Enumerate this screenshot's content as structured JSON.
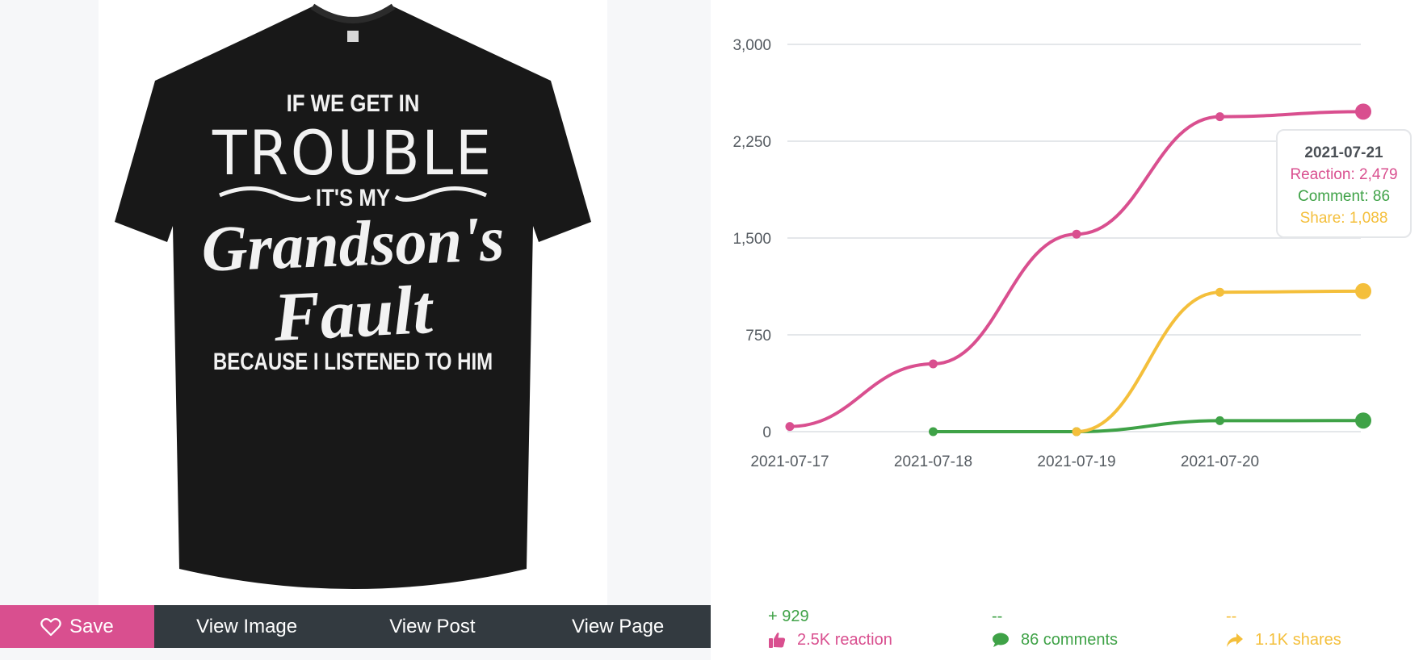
{
  "product": {
    "shirt_text": [
      "IF WE GET IN",
      "TROUBLE",
      "IT'S MY",
      "Grandson's",
      "Fault",
      "BECAUSE I LISTENED TO HIM"
    ]
  },
  "actions": {
    "save_label": "Save",
    "view_image_label": "View Image",
    "view_post_label": "View Post",
    "view_page_label": "View Page"
  },
  "colors": {
    "reaction": "#d94f8f",
    "comment": "#3fa247",
    "share": "#f4bf3b",
    "save_button": "#d94f8f",
    "action_bar": "#333a40"
  },
  "chart_data": {
    "type": "line",
    "x": [
      "2021-07-17",
      "2021-07-18",
      "2021-07-19",
      "2021-07-20",
      "2021-07-21"
    ],
    "x_tick_labels": [
      "2021-07-17",
      "2021-07-18",
      "2021-07-19",
      "2021-07-20"
    ],
    "y_ticks": [
      "0",
      "750",
      "1,500",
      "2,250",
      "3,000"
    ],
    "ylim": [
      0,
      3000
    ],
    "grid": true,
    "series": [
      {
        "name": "Reaction",
        "color": "#d94f8f",
        "values": [
          40,
          525,
          1530,
          2440,
          2479
        ]
      },
      {
        "name": "Comment",
        "color": "#3fa247",
        "values": [
          null,
          0,
          0,
          85,
          86
        ]
      },
      {
        "name": "Share",
        "color": "#f4bf3b",
        "values": [
          null,
          null,
          0,
          1080,
          1088
        ]
      }
    ]
  },
  "tooltip": {
    "date": "2021-07-21",
    "reaction": "Reaction: 2,479",
    "comment": "Comment: 86",
    "share": "Share: 1,088"
  },
  "stats": {
    "reaction": {
      "delta": "+ 929",
      "label": "2.5K reaction",
      "icon": "thumbs-up-icon"
    },
    "comment": {
      "delta": "--",
      "label": "86 comments",
      "icon": "comment-bubble-icon"
    },
    "share": {
      "delta": "--",
      "label": "1.1K shares",
      "icon": "share-arrow-icon"
    }
  }
}
